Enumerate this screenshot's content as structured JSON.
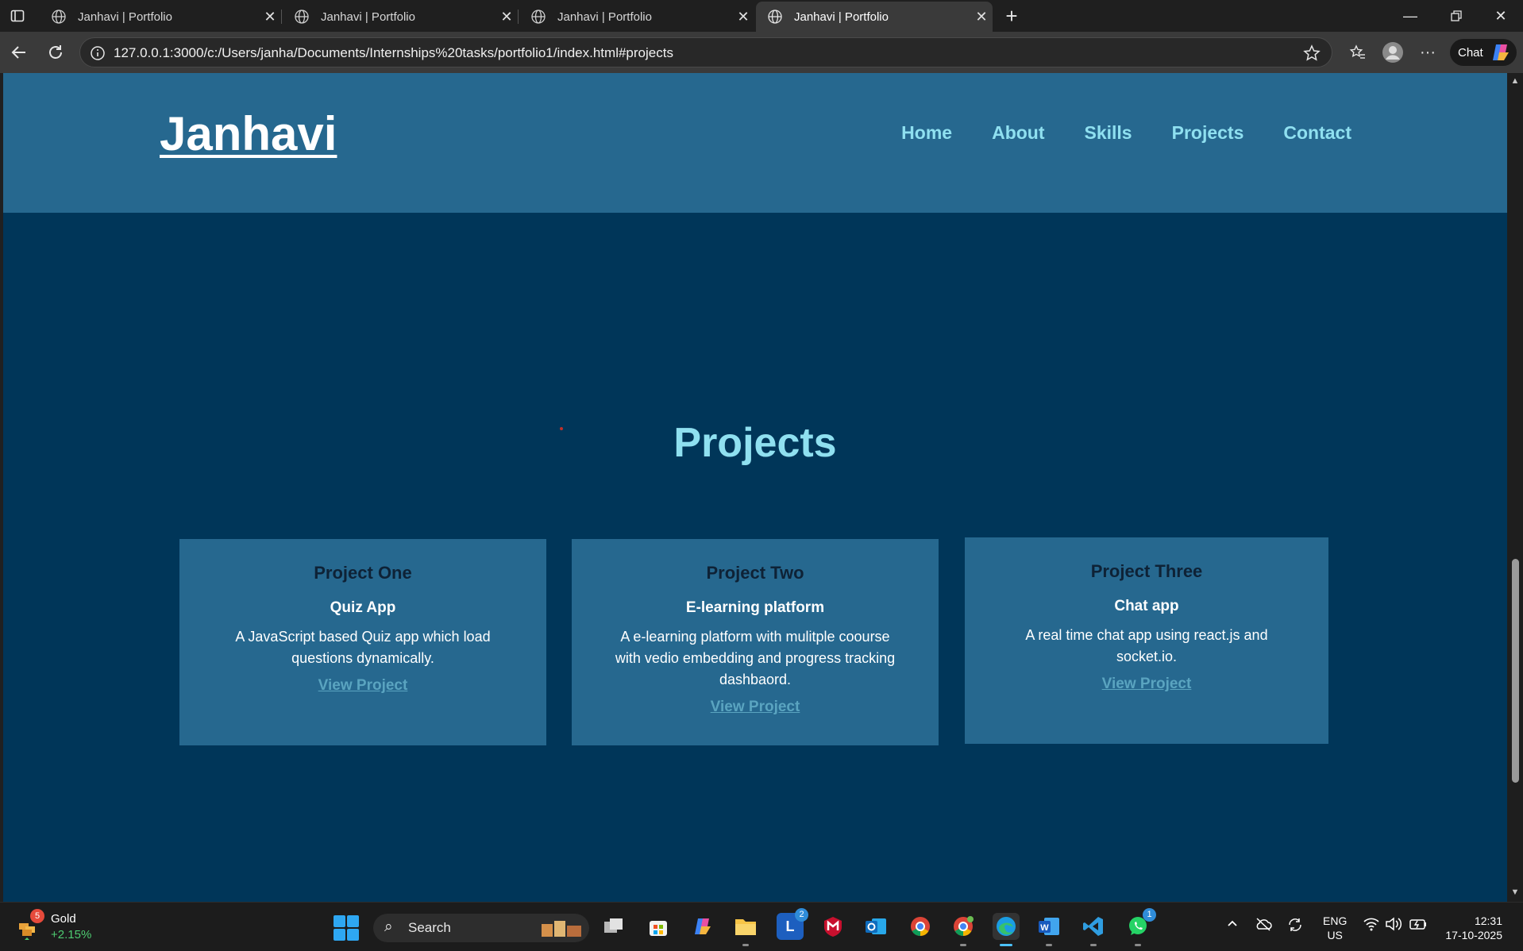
{
  "browser": {
    "tabs": [
      {
        "title": "Janhavi | Portfolio",
        "active": false
      },
      {
        "title": "Janhavi | Portfolio",
        "active": false
      },
      {
        "title": "Janhavi | Portfolio",
        "active": false
      },
      {
        "title": "Janhavi | Portfolio",
        "active": true
      }
    ],
    "new_tab_label": "+",
    "url": "127.0.0.1:3000/c:/Users/janha/Documents/Internships%20tasks/portfolio1/index.html#projects",
    "chat_label": "Chat"
  },
  "site": {
    "logo": "Janhavi",
    "nav": [
      "Home",
      "About",
      "Skills",
      "Projects",
      "Contact"
    ],
    "section_title": "Projects",
    "projects": [
      {
        "heading": "Project One",
        "name": "Quiz App",
        "description": "A JavaScript based Quiz app which load questions dynamically.",
        "link": "View Project"
      },
      {
        "heading": "Project Two",
        "name": "E-learning platform",
        "description": "A e-learning platform with mulitple coourse with vedio embedding and progress tracking dashbaord.",
        "link": "View Project"
      },
      {
        "heading": "Project Three",
        "name": "Chat app",
        "description": "A real time chat app using react.js and socket.io.",
        "link": "View Project"
      }
    ]
  },
  "taskbar": {
    "widget": {
      "badge": "5",
      "name": "Gold",
      "change": "+2.15%"
    },
    "search_label": "Search",
    "apps": [
      {
        "name": "task-view",
        "badge": ""
      },
      {
        "name": "store",
        "badge": ""
      },
      {
        "name": "copilot",
        "badge": ""
      },
      {
        "name": "file-explorer",
        "badge": ""
      },
      {
        "name": "lens",
        "badge": "2"
      },
      {
        "name": "mcafee",
        "badge": ""
      },
      {
        "name": "outlook",
        "badge": ""
      },
      {
        "name": "chrome",
        "badge": ""
      },
      {
        "name": "chrome-profile",
        "badge": ""
      },
      {
        "name": "edge",
        "badge": ""
      },
      {
        "name": "word",
        "badge": ""
      },
      {
        "name": "vscode",
        "badge": ""
      },
      {
        "name": "whatsapp",
        "badge": "1"
      }
    ],
    "language": {
      "line1": "ENG",
      "line2": "US"
    },
    "time": "12:31",
    "date": "17-10-2025"
  },
  "colors": {
    "header_bg": "#26688f",
    "page_bg": "#003659",
    "accent": "#8fe0f0",
    "card_bg": "#26688f",
    "link": "#5aa4c0"
  }
}
